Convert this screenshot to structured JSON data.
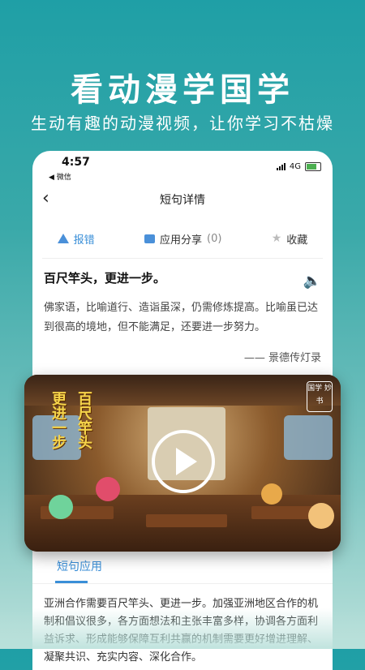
{
  "hero": {
    "title": "看动漫学国学",
    "subtitle": "生动有趣的动漫视频，让你学习不枯燥"
  },
  "status_bar": {
    "time": "4:57",
    "back_app": "◀ 微信",
    "network": "4G"
  },
  "navbar": {
    "back_icon": "‹",
    "title": "短句详情"
  },
  "actions": {
    "report": "报错",
    "share": "应用分享",
    "share_count": "(0)",
    "favorite": "收藏"
  },
  "phrase": {
    "text": "百尺竿头，更进一步。",
    "explanation": "佛家语，比喻道行、造诣虽深，仍需修炼提高。比喻虽已达到很高的境地，但不能满足，还要进一步努力。",
    "source": "—— 景德传灯录"
  },
  "video": {
    "poem_col1": "百尺竿头",
    "poem_col2": "更进一步",
    "stamp": "国学 妙书"
  },
  "tab": {
    "label": "短句应用"
  },
  "application_text": "亚洲合作需要百尺竿头、更进一步。加强亚洲地区合作的机制和倡议很多，各方面想法和主张丰富多样，协调各方面利益诉求、形成能够保障互利共赢的机制需要更好增进理解、凝聚共识、充实内容、深化合作。"
}
